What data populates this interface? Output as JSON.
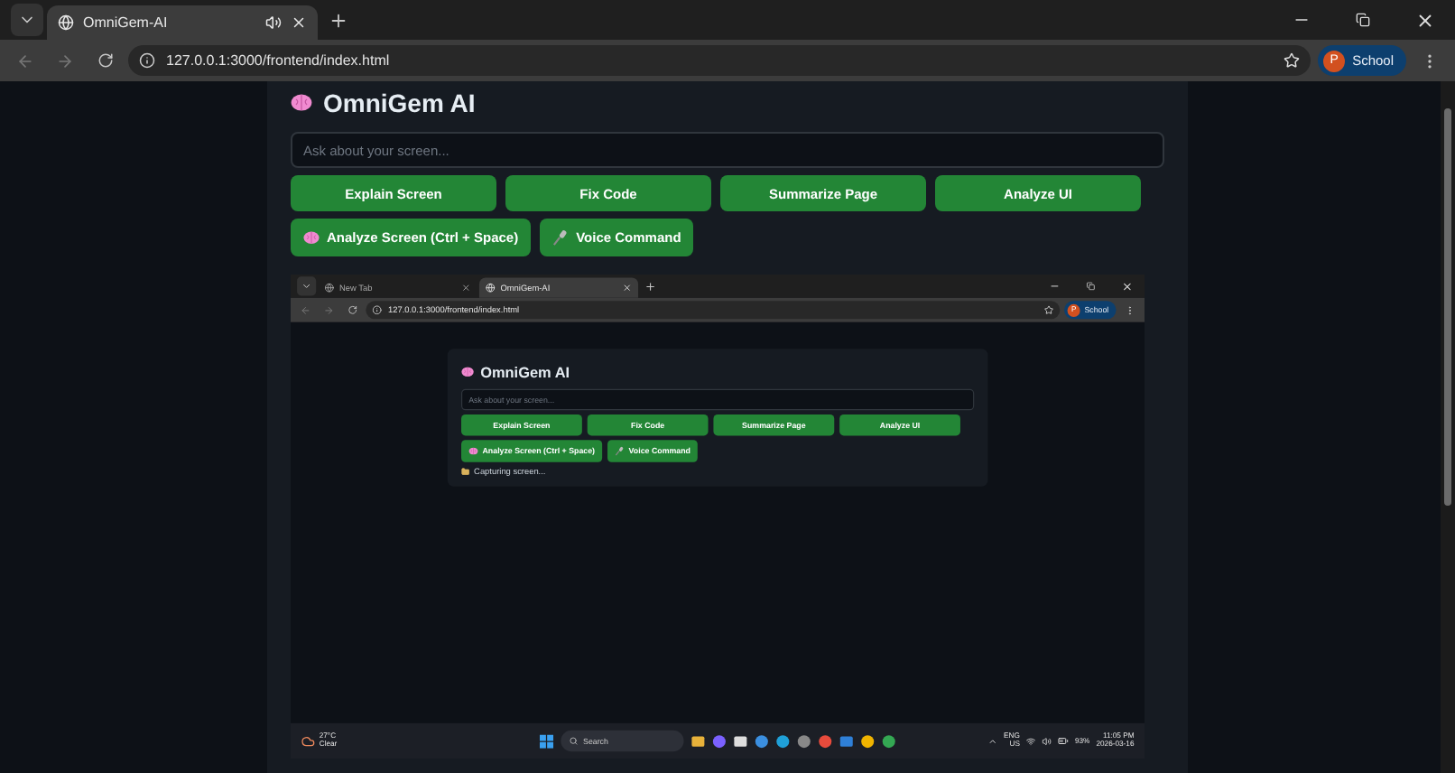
{
  "browser": {
    "tabs": [
      {
        "title": "OmniGem-AI",
        "selected": true,
        "audio": true
      }
    ],
    "url": "127.0.0.1:3000/frontend/index.html",
    "profile": {
      "initial": "P",
      "name": "School"
    }
  },
  "app": {
    "title": "OmniGem AI",
    "input": {
      "placeholder": "Ask about your screen..."
    },
    "actions": [
      "Explain Screen",
      "Fix Code",
      "Summarize Page",
      "Analyze UI"
    ],
    "tools": [
      {
        "label": "Analyze Screen (Ctrl + Space)",
        "kind": "analyze"
      },
      {
        "label": "Voice Command",
        "kind": "voice"
      }
    ]
  },
  "screenshot": {
    "browser": {
      "tabs": [
        {
          "title": "New Tab",
          "selected": false,
          "audio": false
        },
        {
          "title": "OmniGem-AI",
          "selected": true,
          "audio": false
        }
      ],
      "url": "127.0.0.1:3000/frontend/index.html",
      "profile": {
        "initial": "P",
        "name": "School"
      }
    },
    "app": {
      "title": "OmniGem AI",
      "input": {
        "placeholder": "Ask about your screen..."
      },
      "actions": [
        "Explain Screen",
        "Fix Code",
        "Summarize Page",
        "Analyze UI"
      ],
      "tools": [
        {
          "label": "Analyze Screen (Ctrl + Space)",
          "kind": "analyze"
        },
        {
          "label": "Voice Command",
          "kind": "voice"
        }
      ],
      "status": "Capturing screen..."
    },
    "taskbar": {
      "weather": {
        "temperature": "27°C",
        "condition": "Clear"
      },
      "search": {
        "placeholder": "Search"
      },
      "language": {
        "primary": "ENG",
        "secondary": "US"
      },
      "battery": "93%",
      "time": "11:05 PM",
      "date": "2026-03-16"
    }
  }
}
